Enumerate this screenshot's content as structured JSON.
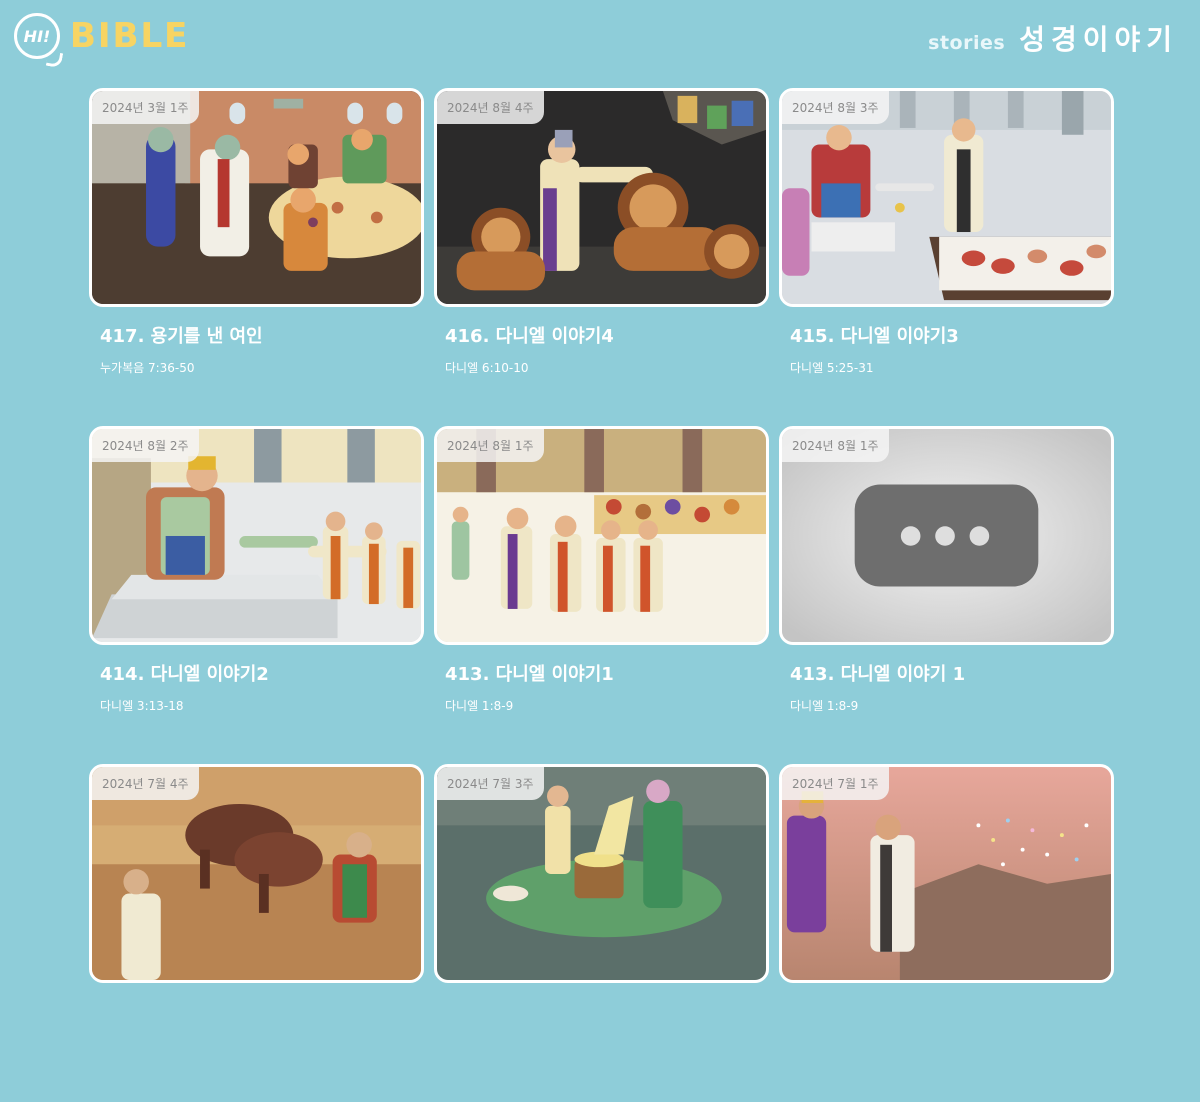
{
  "header": {
    "logo_hi": "HI!",
    "logo_bible": "BIBLE",
    "stories_label": "stories",
    "korean_title": "성경이야기"
  },
  "cards": [
    {
      "date": "2024년 3월 1주",
      "title": "417. 용기를 낸 여인",
      "reference": "누가복음 7:36-50",
      "scene": "feast"
    },
    {
      "date": "2024년 8월 4주",
      "title": "416. 다니엘 이야기4",
      "reference": "다니엘 6:10-10",
      "scene": "lions"
    },
    {
      "date": "2024년 8월 3주",
      "title": "415. 다니엘 이야기3",
      "reference": "다니엘 5:25-31",
      "scene": "palace-feast"
    },
    {
      "date": "2024년 8월 2주",
      "title": "414. 다니엘 이야기2",
      "reference": "다니엘 3:13-18",
      "scene": "king-throne"
    },
    {
      "date": "2024년 8월 1주",
      "title": "413. 다니엘 이야기1",
      "reference": "다니엘 1:8-9",
      "scene": "four-youths"
    },
    {
      "date": "2024년 8월 1주",
      "title": "413. 다니엘 이야기 1",
      "reference": "다니엘 1:8-9",
      "scene": "loading-placeholder"
    },
    {
      "date": "2024년 7월 4주",
      "title": "",
      "reference": "",
      "scene": "oxen-plowing"
    },
    {
      "date": "2024년 7월 3주",
      "title": "",
      "reference": "",
      "scene": "flour-pouring"
    },
    {
      "date": "2024년 7월 1주",
      "title": "",
      "reference": "",
      "scene": "desert-sparkles"
    }
  ]
}
